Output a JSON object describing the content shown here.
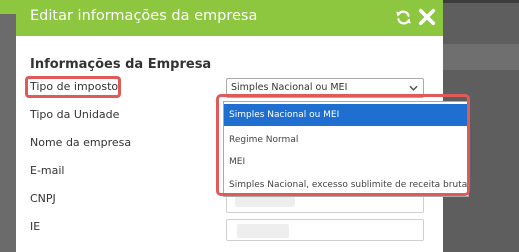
{
  "modal": {
    "title": "Editar informações da empresa",
    "refresh_icon": "refresh-icon",
    "close_icon": "close-icon"
  },
  "form": {
    "section_title": "Informações da Empresa",
    "labels": {
      "tipo_imposto": "Tipo de imposto",
      "tipo_unidade": "Tipo da Unidade",
      "nome_empresa": "Nome da empresa",
      "email": "E-mail",
      "cnpj": "CNPJ",
      "ie": "IE"
    },
    "tipo_imposto_select": {
      "value": "Simples Nacional ou MEI",
      "options": [
        "Simples Nacional ou MEI",
        "Regime Normal",
        "MEI",
        "Simples Nacional, excesso sublimite de receita bruta"
      ],
      "selected_index": 0
    }
  },
  "colors": {
    "header": "#8dc63f",
    "highlight": "#e05a5a",
    "selected_option": "#1e6fd0"
  }
}
